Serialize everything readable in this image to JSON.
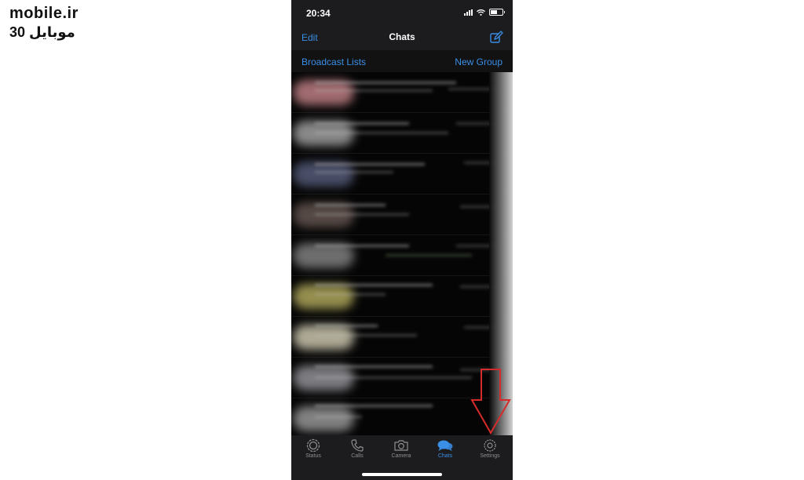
{
  "watermark": {
    "line1": "mobile.ir",
    "line2": "موبایل 30"
  },
  "status_bar": {
    "time": "20:34"
  },
  "nav": {
    "edit_label": "Edit",
    "title": "Chats",
    "compose_icon": "compose-icon"
  },
  "subbar": {
    "broadcast_label": "Broadcast Lists",
    "new_group_label": "New Group"
  },
  "tabs": [
    {
      "label": "Status",
      "icon": "status-icon",
      "active": false
    },
    {
      "label": "Calls",
      "icon": "phone-icon",
      "active": false
    },
    {
      "label": "Camera",
      "icon": "camera-icon",
      "active": false
    },
    {
      "label": "Chats",
      "icon": "chat-bubbles-icon",
      "active": true
    },
    {
      "label": "Settings",
      "icon": "gear-icon",
      "active": false
    }
  ],
  "colors": {
    "accent": "#3a8ee6",
    "annotation_arrow": "#d62b2b"
  }
}
